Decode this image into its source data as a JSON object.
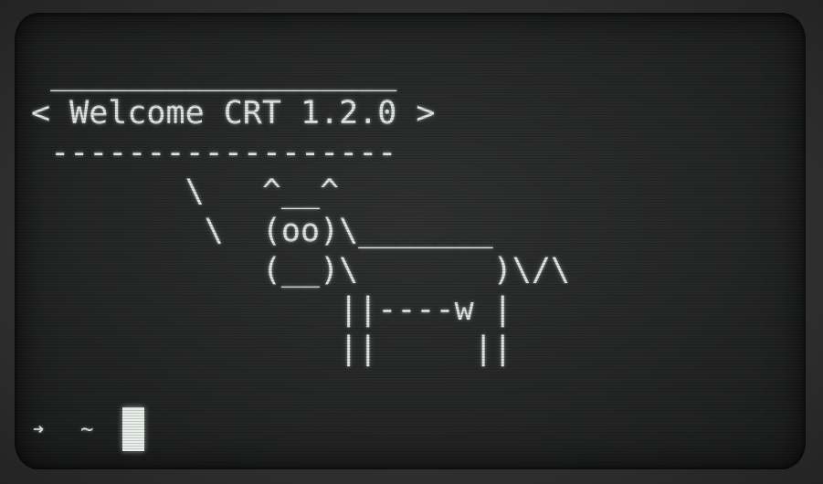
{
  "terminal": {
    "lines": [
      " __________________",
      "< Welcome CRT 1.2.0 >",
      " ------------------",
      "        \\   ^__^",
      "         \\  (oo)\\_______",
      "            (__)\\       )\\/\\",
      "                ||----w |",
      "                ||     ||"
    ]
  },
  "prompt": {
    "arrow": "➜",
    "path": "~"
  },
  "colors": {
    "phosphor": "#dfe6e3",
    "screen": "#262727",
    "bezel": "#3a3a3a"
  }
}
